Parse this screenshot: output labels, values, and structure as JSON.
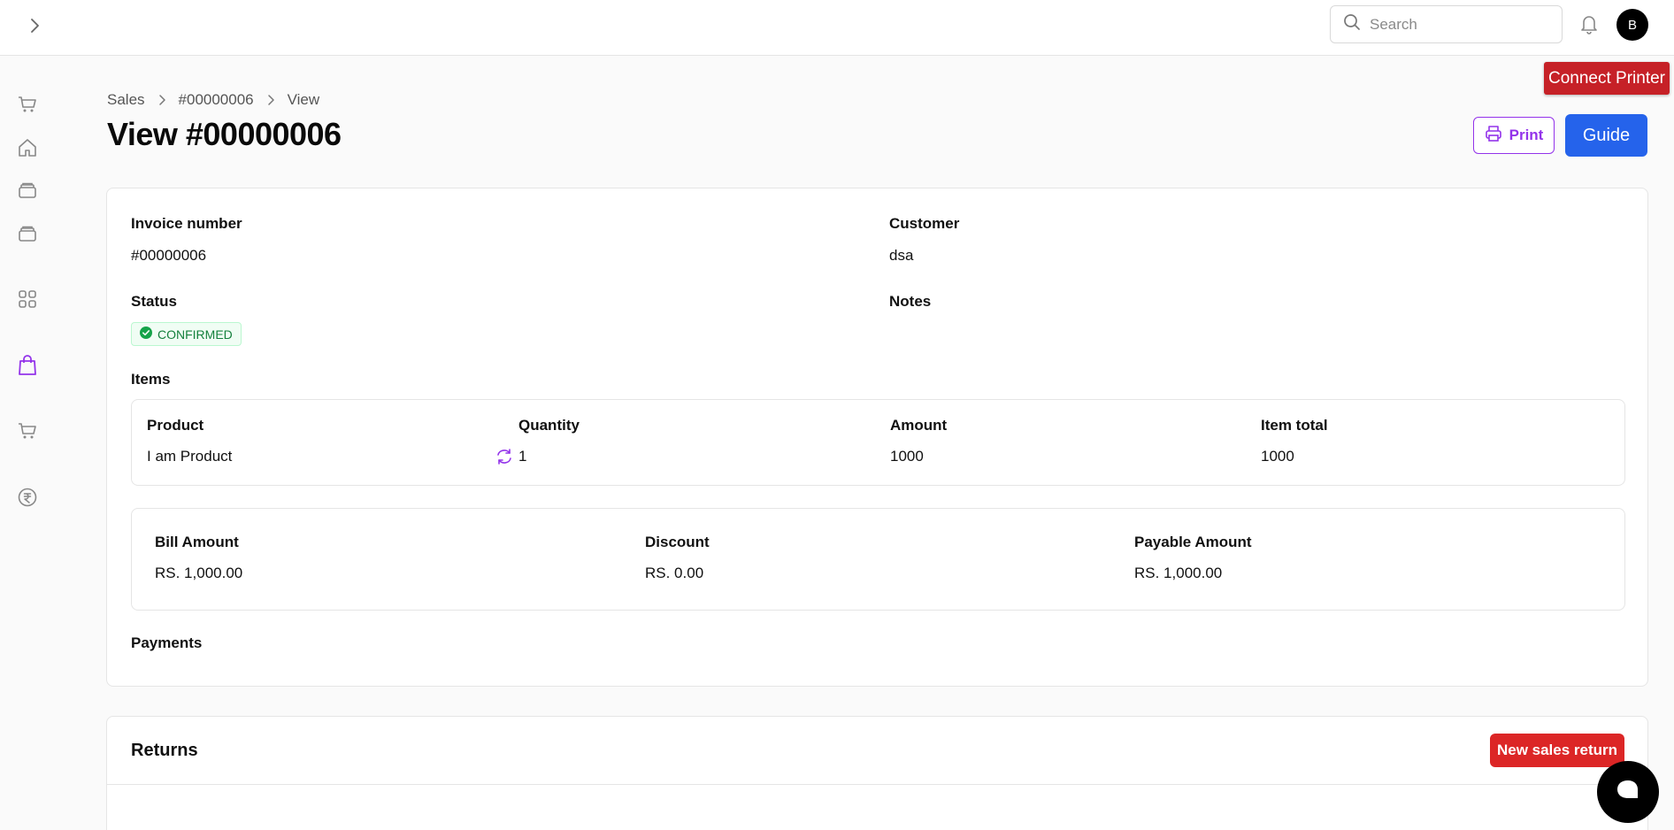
{
  "topbar": {
    "search_placeholder": "Search",
    "avatar_initial": "B"
  },
  "floating": {
    "connect_printer": "Connect Printer"
  },
  "sidebar": {
    "items": [
      {
        "icon": "cart-icon"
      },
      {
        "icon": "home-icon"
      },
      {
        "icon": "stack-icon"
      },
      {
        "icon": "stack-icon"
      },
      {
        "icon": "grid-icon"
      },
      {
        "icon": "shopping-bag-icon",
        "active": true
      },
      {
        "icon": "cart-icon"
      },
      {
        "icon": "rupee-icon"
      }
    ]
  },
  "breadcrumb": [
    "Sales",
    "#00000006",
    "View"
  ],
  "page": {
    "title": "View #00000006",
    "print_label": "Print",
    "guide_label": "Guide"
  },
  "details": {
    "invoice_label": "Invoice number",
    "invoice_value": "#00000006",
    "customer_label": "Customer",
    "customer_value": "dsa",
    "status_label": "Status",
    "status_value": "CONFIRMED",
    "notes_label": "Notes",
    "items_label": "Items",
    "payments_label": "Payments"
  },
  "items_table": {
    "headers": [
      "Product",
      "Quantity",
      "Amount",
      "Item total"
    ],
    "rows": [
      [
        "I am Product",
        "1",
        "1000",
        "1000"
      ]
    ]
  },
  "totals": {
    "bill_label": "Bill Amount",
    "bill_value": "RS. 1,000.00",
    "discount_label": "Discount",
    "discount_value": "RS. 0.00",
    "payable_label": "Payable Amount",
    "payable_value": "RS. 1,000.00"
  },
  "returns": {
    "title": "Returns",
    "new_button": "New sales return"
  },
  "colors": {
    "accent_purple": "#9333ea",
    "guide_blue": "#2563eb",
    "danger_red": "#dc2626",
    "status_green": "#15803d"
  }
}
